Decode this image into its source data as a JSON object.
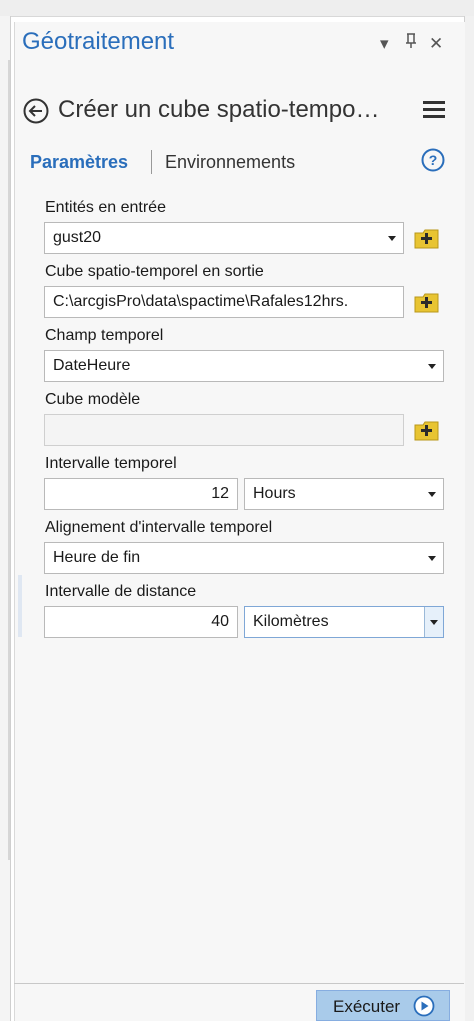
{
  "pane": {
    "title": "Géotraitement",
    "controls": {
      "dropdown": "▾",
      "pin": "ᵖ",
      "close": "✕"
    }
  },
  "tool": {
    "title": "Créer un cube spatio-tempo…"
  },
  "tabs": {
    "parameters": "Paramètres",
    "environments": "Environnements"
  },
  "form": {
    "input_features": {
      "label": "Entités en entrée",
      "value": "gust20"
    },
    "output_cube": {
      "label": "Cube spatio-temporel en sortie",
      "value": "C:\\arcgisPro\\data\\spactime\\Rafales12hrs."
    },
    "time_field": {
      "label": "Champ temporel",
      "value": "DateHeure"
    },
    "template_cube": {
      "label": "Cube modèle",
      "value": ""
    },
    "time_step_interval": {
      "label": "Intervalle temporel",
      "value": "12",
      "unit": "Hours"
    },
    "time_step_alignment": {
      "label": "Alignement d'intervalle temporel",
      "value": "Heure de fin"
    },
    "distance_interval": {
      "label": "Intervalle de distance",
      "value": "40",
      "unit": "Kilomètres"
    }
  },
  "footer": {
    "run_label": "Exécuter"
  },
  "colors": {
    "accent": "#2a6ebb",
    "browse_icon": "#e8c432",
    "run_button": "#a9cbea"
  }
}
